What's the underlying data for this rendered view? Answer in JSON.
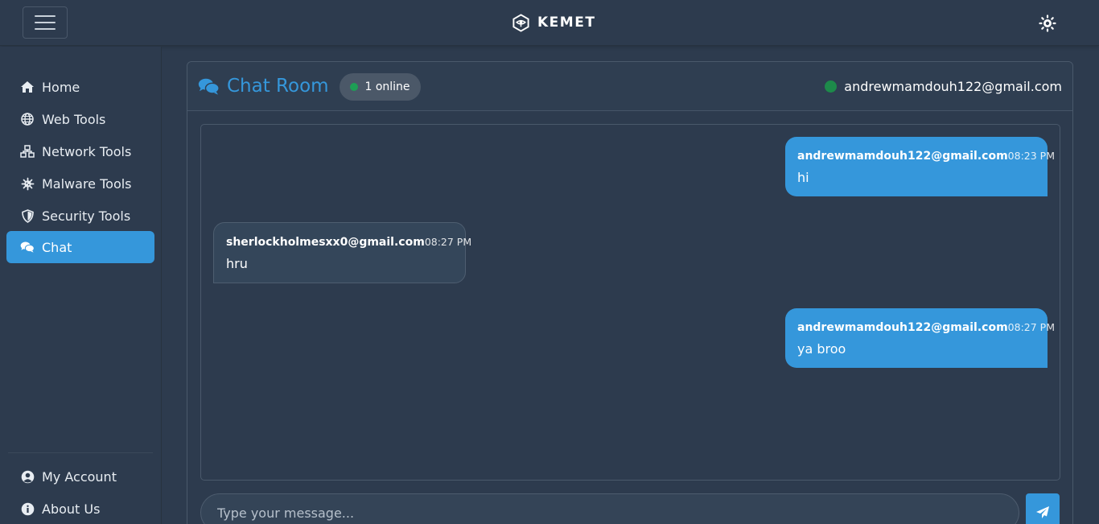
{
  "app": {
    "brand": "KEMET"
  },
  "sidebar": {
    "items": [
      {
        "label": "Home",
        "icon": "home-icon"
      },
      {
        "label": "Web Tools",
        "icon": "globe-icon"
      },
      {
        "label": "Network Tools",
        "icon": "network-icon"
      },
      {
        "label": "Malware Tools",
        "icon": "virus-icon"
      },
      {
        "label": "Security Tools",
        "icon": "shield-icon"
      },
      {
        "label": "Chat",
        "icon": "chat-icon",
        "active": true
      }
    ],
    "bottom_items": [
      {
        "label": "My Account",
        "icon": "user-circle-icon"
      },
      {
        "label": "About Us",
        "icon": "info-circle-icon"
      }
    ]
  },
  "chat": {
    "title": "Chat Room",
    "online_count": "1 online",
    "current_user": "andrewmamdouh122@gmail.com",
    "messages": [
      {
        "sender": "andrewmamdouh122@gmail.com",
        "time": "08:23 PM",
        "text": "hi",
        "mine": true
      },
      {
        "sender": "sherlockholmesxx0@gmail.com",
        "time": "08:27 PM",
        "text": "hru",
        "mine": false
      },
      {
        "sender": "andrewmamdouh122@gmail.com",
        "time": "08:27 PM",
        "text": "ya broo",
        "mine": true
      }
    ],
    "input_placeholder": "Type your message...",
    "input_value": ""
  },
  "colors": {
    "background": "#2d3b4e",
    "accent": "#3597db",
    "online": "#1e9e55"
  }
}
